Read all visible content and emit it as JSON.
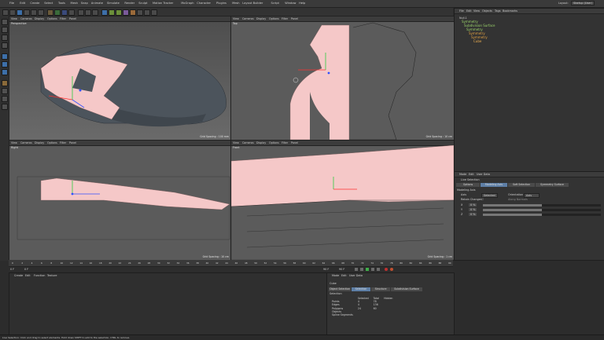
{
  "menus": [
    "File",
    "Edit",
    "Create",
    "Select",
    "Tools",
    "Mesh",
    "Snap",
    "Animate",
    "Simulate",
    "Render",
    "Sculpt",
    "Motion Tracker",
    "MoGraph",
    "Character",
    "Plugins",
    "Mesh",
    "Layout Builder",
    "Script",
    "Window",
    "Help"
  ],
  "layout": {
    "label": "Layout:",
    "value": "Startup (User)"
  },
  "viewports": {
    "menu": [
      "View",
      "Cameras",
      "Display",
      "Options",
      "Filter",
      "Panel"
    ],
    "perspective": {
      "name": "Perspective",
      "grid": "Grid Spacing : 100 mm"
    },
    "top": {
      "name": "Top",
      "grid": "Grid Spacing : 10 cm"
    },
    "right": {
      "name": "Right",
      "grid": "Grid Spacing : 10 cm"
    },
    "front": {
      "name": "Front",
      "grid": "Grid Spacing : 1 cm"
    }
  },
  "object_manager": {
    "menu": [
      "File",
      "Edit",
      "View",
      "Objects",
      "Tags",
      "Bookmarks"
    ],
    "items": [
      {
        "label": "Null.1",
        "color": "#d6d6d6"
      },
      {
        "label": "Symmetry",
        "color": "#9bd46a"
      },
      {
        "label": "Subdivision Surface",
        "color": "#9bd46a"
      },
      {
        "label": "Symmetry",
        "color": "#9bd46a"
      },
      {
        "label": "Symmetry",
        "color": "#e0a040"
      },
      {
        "label": "Symmetry",
        "color": "#e0a040"
      },
      {
        "label": "Cube",
        "color": "#f0b050"
      }
    ]
  },
  "attr_top": {
    "menu": [
      "Mode",
      "Edit",
      "User Data"
    ],
    "title": "Live Selection",
    "tabs": [
      "Options",
      "Modeling Axis",
      "Soft Selection",
      "Symmetry Surface"
    ],
    "section": "Modeling Axis",
    "axis_label": "Axis",
    "axis_value": "Selected",
    "orientation_label": "Orientation",
    "orientation_value": "Axis",
    "retain_label": "Retain Changes",
    "along_normal": "Along Normals",
    "xyz": [
      "X",
      "Y",
      "Z"
    ],
    "values": [
      "0 %",
      "0 %",
      "0 %"
    ],
    "slider_levels": [
      0.5,
      0.5,
      0.5
    ]
  },
  "attr_bottom": {
    "menu": [
      "Mode",
      "Edit",
      "User Data"
    ],
    "object": "Cube",
    "tabs": [
      "Object Selection",
      "Selection",
      "Structure",
      "Subdivision Surface"
    ],
    "table_title": "Selection",
    "headers": [
      "",
      "Selected",
      "Total",
      "Hidden"
    ],
    "rows": [
      [
        "Points",
        "4",
        "78",
        ""
      ],
      [
        "Edges",
        "4",
        "136",
        ""
      ],
      [
        "Polygons",
        "24",
        "60",
        ""
      ],
      [
        "Objects",
        "",
        "",
        ""
      ],
      [
        "Spline Segments",
        "",
        "",
        ""
      ]
    ]
  },
  "material_menu": [
    "Create",
    "Edit",
    "Function",
    "Texture"
  ],
  "timeline": {
    "ticks": [
      "0",
      "2",
      "4",
      "6",
      "8",
      "10",
      "12",
      "14",
      "16",
      "18",
      "20",
      "22",
      "24",
      "26",
      "28",
      "30",
      "32",
      "34",
      "36",
      "38",
      "40",
      "42",
      "44",
      "46",
      "48",
      "50",
      "52",
      "54",
      "56",
      "58",
      "60",
      "62",
      "64",
      "66",
      "68",
      "70",
      "72",
      "74",
      "76",
      "78",
      "80",
      "82",
      "84",
      "86",
      "88",
      "90"
    ],
    "start": "0 F",
    "current": "0 F",
    "end": "90 F",
    "end2": "90 F"
  },
  "status": "Live Selection: Click and drag to select elements. Hold down SHIFT to add to the selection, CTRL to remove."
}
